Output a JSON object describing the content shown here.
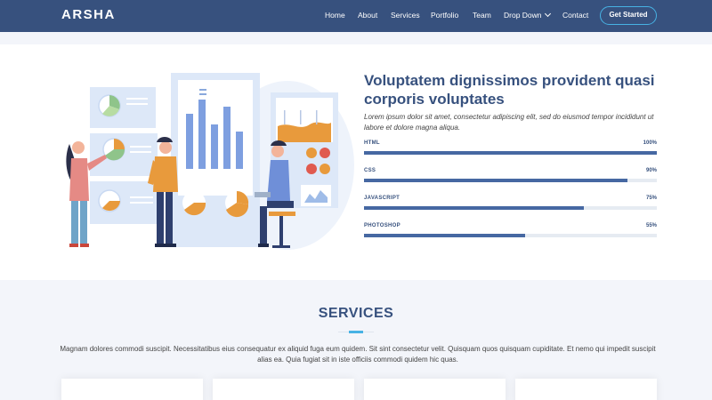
{
  "header": {
    "logo": "ARSHA",
    "nav": [
      "Home",
      "About",
      "Services",
      "Portfolio",
      "Team",
      "Drop Down",
      "Contact"
    ],
    "cta_label": "Get Started"
  },
  "skills": {
    "title": "Voluptatem dignissimos provident quasi corporis voluptates",
    "description": "Lorem ipsum dolor sit amet, consectetur adipiscing elit, sed do eiusmod tempor incididunt ut labore et dolore magna aliqua.",
    "items": [
      {
        "name": "HTML",
        "value": "100%",
        "level": 100
      },
      {
        "name": "CSS",
        "value": "90%",
        "level": 90
      },
      {
        "name": "JAVASCRIPT",
        "value": "75%",
        "level": 75
      },
      {
        "name": "PHOTOSHOP",
        "value": "55%",
        "level": 55
      }
    ]
  },
  "services": {
    "title": "SERVICES",
    "description": "Magnam dolores commodi suscipit. Necessitatibus eius consequatur ex aliquid fuga eum quidem. Sit sint consectetur velit. Quisquam quos quisquam cupiditate. Et nemo qui impedit suscipit alias ea. Quia fugiat sit in iste officiis commodi quidem hic quas."
  },
  "colors": {
    "header_bg": "#37517e",
    "accent": "#47b2e4",
    "bar_fill": "#4668a2",
    "bar_track": "#e6ebf2",
    "illustration_orange": "#e89a3c"
  },
  "icons": [
    "chevron-down-icon",
    "skills-illustration"
  ]
}
